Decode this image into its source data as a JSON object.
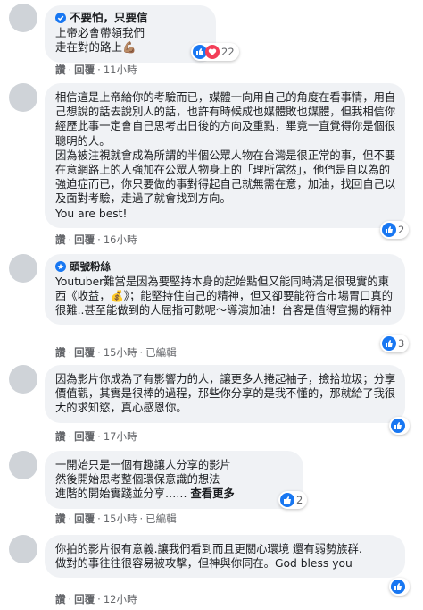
{
  "comments": [
    {
      "author": "不要怕，只要信",
      "text": "上帝必會帶領我們\n走在對的路上💪🏽",
      "actions": {
        "like": "讚",
        "reply": "回覆",
        "time": "11小時"
      },
      "reactions": {
        "count": "22"
      }
    },
    {
      "text": "相信這是上帝給你的考驗而已，媒體一向用自己的角度在看事情，用自己想說的話去說別人的話，也許有時候成也媒體敗也媒體，但我相信你經歷此事一定會自己思考出日後的方向及重點，畢竟一直覺得你是個很聰明的人。\n因為被注視就會成為所謂的半個公眾人物在台灣是很正常的事，但不要在意網路上的人強加在公眾人物身上的「理所當然」，他們是自以為的強迫症而已，你只要做的事對得起自己就無需在意，加油，找回自己以及面對考驗，走過了就會找到方向。\nYou are best!",
      "actions": {
        "like": "讚",
        "reply": "回覆",
        "time": "16小時"
      },
      "reactions": {
        "count": "2"
      }
    },
    {
      "author": "頭號粉絲",
      "text": "Youtuber難當是因為要堅持本身的起始點但又能同時滿足很現實的東西《收益，💰》；能堅持住自己的精神，但又卻要能符合市場胃口真的很難..甚至能做到的人屈指可數呢～導演加油！台客是值得宣揚的精神",
      "actions": {
        "like": "讚",
        "reply": "回覆",
        "time": "15小時",
        "edited": "已編輯"
      },
      "reactions": {
        "count": "3"
      }
    },
    {
      "text": "因為影片你成為了有影響力的人，讓更多人捲起袖子，撿拾垃圾；分享價值觀，其實是很棒的過程，那些你分享的是我不懂的，那就給了我很大的求知慾，真心感恩你。",
      "actions": {
        "like": "讚",
        "reply": "回覆",
        "time": "17小時"
      },
      "reactions": {
        "count": ""
      }
    },
    {
      "text": "一開始只是一個有趣讓人分享的影片\n然後開始思考整個環保意識的想法\n進階的開始實踐並分享……",
      "see_more": "查看更多",
      "actions": {
        "like": "讚",
        "reply": "回覆",
        "time": "15小時",
        "edited": "已編輯"
      },
      "reactions": {
        "count": "2"
      }
    },
    {
      "text": "你拍的影片很有意義.讓我們看到而且更關心環境 還有弱勢族群.\n做對的事往往很容易被攻擊，但神與你同在。God bless you",
      "actions": {
        "like": "讚",
        "reply": "回覆",
        "time": "12小時"
      },
      "reactions": {
        "count": ""
      }
    }
  ]
}
